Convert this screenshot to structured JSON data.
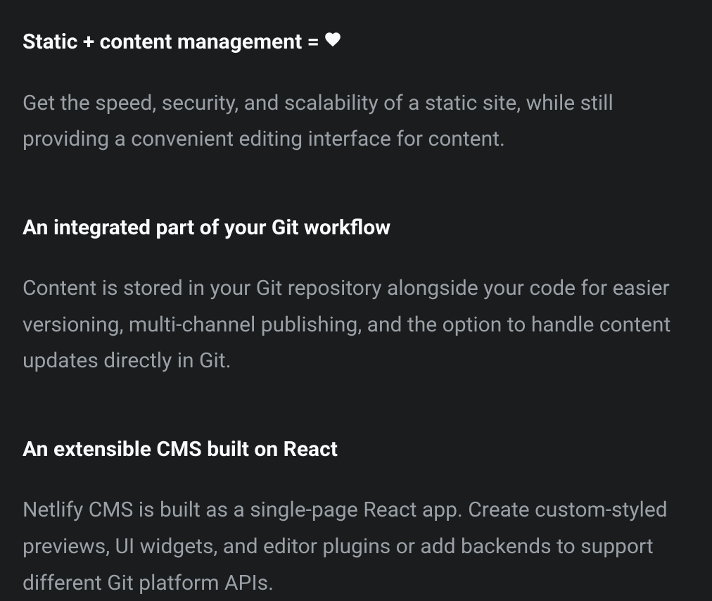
{
  "sections": [
    {
      "heading": "Static + content management = ",
      "has_heart_icon": true,
      "body": "Get the speed, security, and scalability of a static site, while still providing a convenient editing interface for content."
    },
    {
      "heading": "An integrated part of your Git workflow",
      "has_heart_icon": false,
      "body": "Content is stored in your Git repository alongside your code for easier versioning, multi-channel publishing, and the option to handle content updates directly in Git."
    },
    {
      "heading": "An extensible CMS built on React",
      "has_heart_icon": false,
      "body": "Netlify CMS is built as a single-page React app. Create custom-styled previews, UI widgets, and editor plugins or add backends to support different Git platform APIs."
    }
  ]
}
